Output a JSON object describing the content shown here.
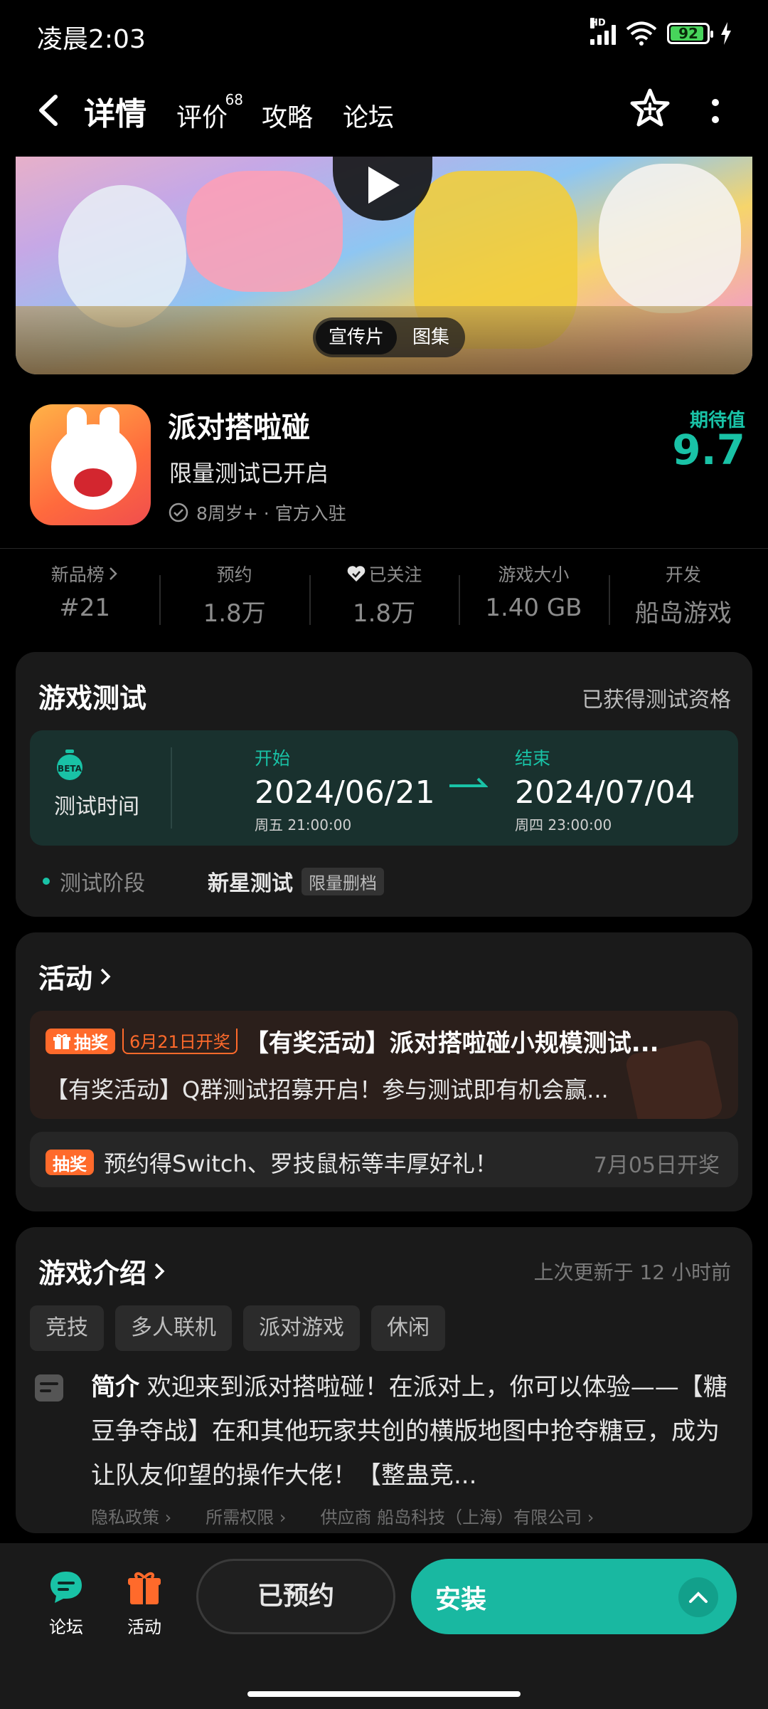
{
  "status_bar": {
    "time": "凌晨2:03",
    "network_label": "HD",
    "battery": "92"
  },
  "nav": {
    "tabs": [
      {
        "label": "详情"
      },
      {
        "label": "评价",
        "badge": "68"
      },
      {
        "label": "攻略"
      },
      {
        "label": "论坛"
      }
    ],
    "accent": "#19b8a1"
  },
  "banner": {
    "options": [
      "宣传片",
      "图集"
    ]
  },
  "app": {
    "name": "派对搭啦碰",
    "subtitle": "限量测试已开启",
    "meta": "8周岁+ · 官方入驻",
    "expect_label": "期待值",
    "expect_value": "9.7"
  },
  "stats": [
    {
      "label": "新品榜",
      "value": "#21",
      "chevron": true
    },
    {
      "label": "预约",
      "value": "1.8万"
    },
    {
      "label": "已关注",
      "value": "1.8万",
      "icon": "heart-check-icon"
    },
    {
      "label": "游戏大小",
      "value": "1.40 GB"
    },
    {
      "label": "开发",
      "value": "船岛游戏"
    }
  ],
  "test": {
    "title": "游戏测试",
    "status": "已获得测试资格",
    "time_label": "测试时间",
    "beta_badge": "BETA",
    "start": {
      "label": "开始",
      "date": "2024/06/21",
      "weekday_time": "周五 21:00:00"
    },
    "end": {
      "label": "结束",
      "date": "2024/07/04",
      "weekday_time": "周四 23:00:00"
    },
    "phase_label": "测试阶段",
    "phase_value": "新星测试",
    "phase_tag": "限量删档"
  },
  "activity": {
    "title": "活动",
    "items": [
      {
        "tag": "抽奖",
        "date_tag": "6月21日开奖",
        "title": "【有奖活动】派对搭啦碰小规模测试...",
        "desc": "【有奖活动】Q群测试招募开启！参与测试即有机会赢..."
      },
      {
        "tag": "抽奖",
        "title": "预约得Switch、罗技鼠标等丰厚好礼！",
        "date": "7月05日开奖"
      }
    ]
  },
  "intro": {
    "title": "游戏介绍",
    "updated": "上次更新于 12 小时前",
    "tags": [
      "竞技",
      "多人联机",
      "派对游戏",
      "休闲"
    ],
    "label": "简介",
    "text": "欢迎来到派对搭啦碰！在派对上，你可以体验——【糖豆争夺战】在和其他玩家共创的横版地图中抢夺糖豆，成为让队友仰望的操作大佬！【整蛊竞...",
    "links": [
      "隐私政策",
      "所需权限",
      "供应商 船岛科技（上海）有限公司"
    ]
  },
  "bottom": {
    "forum": "论坛",
    "activity": "活动",
    "reserved": "已预约",
    "install": "安装"
  }
}
